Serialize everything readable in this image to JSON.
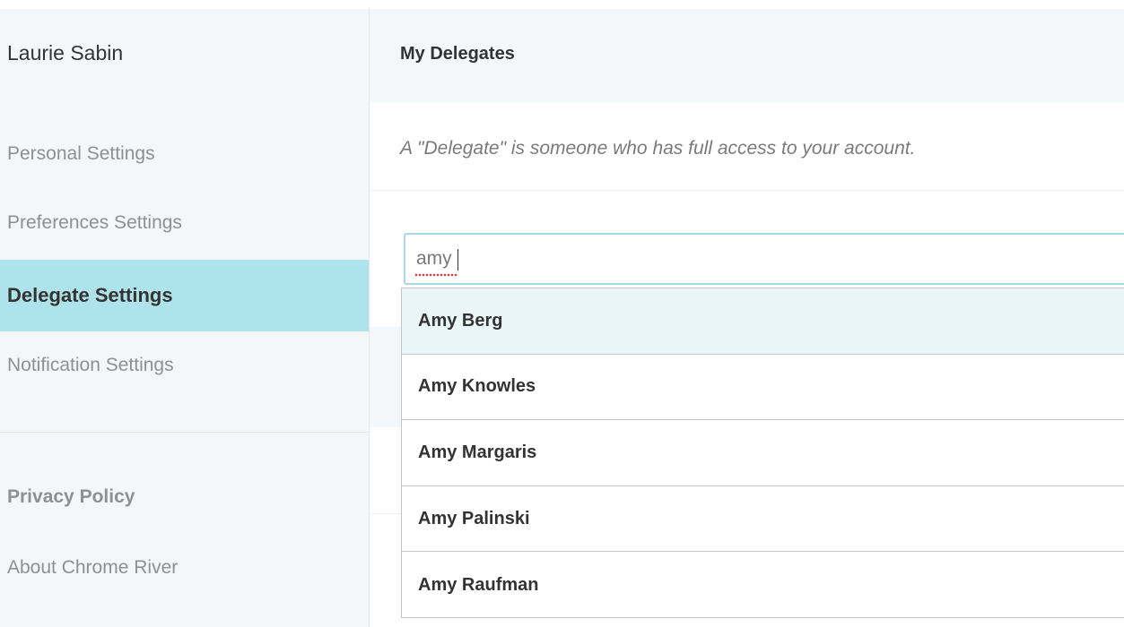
{
  "sidebar": {
    "user_name": "Laurie Sabin",
    "nav": [
      {
        "label": "Personal Settings",
        "active": false
      },
      {
        "label": "Preferences Settings",
        "active": false
      },
      {
        "label": "Delegate Settings",
        "active": true
      },
      {
        "label": "Notification Settings",
        "active": false
      }
    ],
    "links": [
      {
        "label": "Privacy Policy"
      },
      {
        "label": "About Chrome River"
      }
    ]
  },
  "main": {
    "title": "My Delegates",
    "description": "A \"Delegate\" is someone who has full access to your account.",
    "search": {
      "value": "amy"
    },
    "results": [
      {
        "name": "Amy Berg",
        "highlighted": true
      },
      {
        "name": "Amy Knowles",
        "highlighted": false
      },
      {
        "name": "Amy Margaris",
        "highlighted": false
      },
      {
        "name": "Amy Palinski",
        "highlighted": false
      },
      {
        "name": "Amy Raufman",
        "highlighted": false
      }
    ]
  },
  "colors": {
    "active_nav": "#aee3ec",
    "highlight_row": "#e9f6f8",
    "input_border": "#a6d8ea",
    "panel_bg": "#f4f7fa"
  }
}
